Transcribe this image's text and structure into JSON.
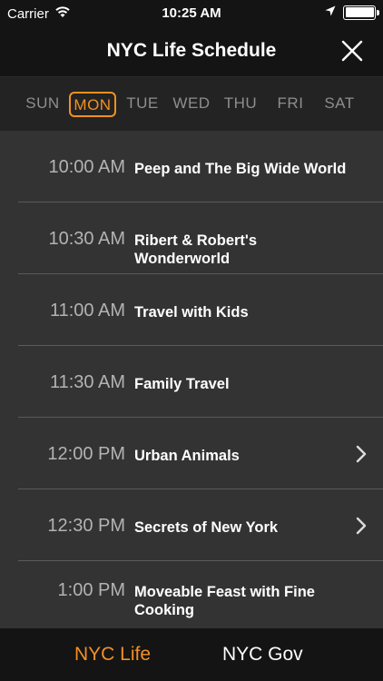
{
  "status_bar": {
    "carrier": "Carrier",
    "time": "10:25 AM",
    "icons": [
      "wifi-icon",
      "location-arrow-icon",
      "battery-icon"
    ]
  },
  "header": {
    "title": "NYC Life Schedule",
    "close_icon": "close-icon"
  },
  "days": [
    {
      "label": "SUN",
      "selected": false
    },
    {
      "label": "MON",
      "selected": true
    },
    {
      "label": "TUE",
      "selected": false
    },
    {
      "label": "WED",
      "selected": false
    },
    {
      "label": "THU",
      "selected": false
    },
    {
      "label": "FRI",
      "selected": false
    },
    {
      "label": "SAT",
      "selected": false
    }
  ],
  "schedule": [
    {
      "time": "10:00 AM",
      "title": "Peep and The Big Wide World",
      "has_chevron": false
    },
    {
      "time": "10:30 AM",
      "title": "Ribert & Robert's Wonderworld",
      "has_chevron": false
    },
    {
      "time": "11:00 AM",
      "title": "Travel with Kids",
      "has_chevron": false
    },
    {
      "time": "11:30 AM",
      "title": "Family Travel",
      "has_chevron": false
    },
    {
      "time": "12:00 PM",
      "title": "Urban Animals",
      "has_chevron": true
    },
    {
      "time": "12:30 PM",
      "title": "Secrets of New York",
      "has_chevron": true
    },
    {
      "time": "1:00 PM",
      "title": "Moveable Feast with Fine Cooking",
      "has_chevron": false
    }
  ],
  "tabs": [
    {
      "label": "NYC Life",
      "selected": true
    },
    {
      "label": "NYC Gov",
      "selected": false
    }
  ],
  "colors": {
    "accent": "#f39023",
    "list_bg": "#333333",
    "bar_bg": "#141414",
    "day_bar_bg": "#232323",
    "time_text": "#b3b3b3",
    "inactive_day": "#8e8e8e"
  }
}
